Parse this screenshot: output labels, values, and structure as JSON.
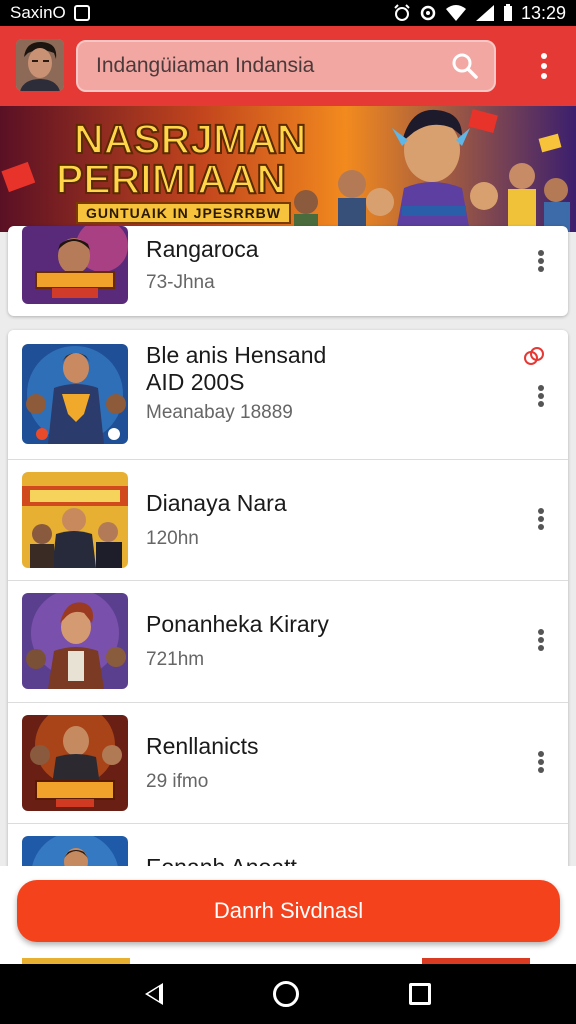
{
  "status_bar": {
    "carrier": "SaxinO",
    "time": "13:29",
    "icons": [
      "notification-box-icon",
      "alarm-icon",
      "sync-icon",
      "wifi-icon",
      "signal-icon",
      "battery-icon"
    ]
  },
  "app_bar": {
    "search_text": "Indangüiaman Indansia",
    "search_icon": "search-icon",
    "menu_icon": "overflow-menu-icon",
    "accent": "#e53935"
  },
  "banner": {
    "line1": "NASRJMAN",
    "line2": "PERIMIAAN",
    "subline": "GUNTUAIK IN JPESRRBW"
  },
  "list": {
    "first_card": {
      "title": "Rangaroca",
      "subtitle": "73-Jhna"
    },
    "items": [
      {
        "title": "Ble anis Hensand\nAID 200S",
        "subtitle": "Meanabay 18889",
        "pin_icon": "link-icon"
      },
      {
        "title": "Dianaya Nara",
        "subtitle": "120hn"
      },
      {
        "title": "Ponanheka Kirary",
        "subtitle": "721hm"
      },
      {
        "title": "Renllanicts",
        "subtitle": "29 ifmo"
      },
      {
        "title": "Eonanh Anoatt",
        "subtitle": ""
      }
    ]
  },
  "action_button": {
    "label": "Danrh Sivdnasl",
    "color": "#f4421d"
  },
  "nav_bar": {
    "back": "back-icon",
    "home": "home-icon",
    "recents": "recents-icon"
  }
}
